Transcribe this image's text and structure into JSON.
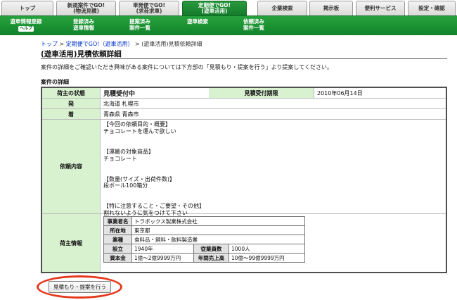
{
  "nav": {
    "tabs": [
      {
        "line1": "トップ",
        "line2": ""
      },
      {
        "line1": "新規案件でGO!",
        "line2": "(物流見積)"
      },
      {
        "line1": "単発便でGO!",
        "line2": "(求荷求車)"
      },
      {
        "line1": "定期便でGO!",
        "line2": "(遊車活用)"
      },
      {
        "line1": "企業検索",
        "line2": ""
      },
      {
        "line1": "掲示板",
        "line2": ""
      },
      {
        "line1": "便利サービス",
        "line2": ""
      },
      {
        "line1": "設定・確認",
        "line2": ""
      }
    ],
    "sub": [
      {
        "line1": "遊車情報登録",
        "line2": "",
        "badge": "ヘルプ"
      },
      {
        "line1": "登録済み",
        "line2": "遊車情報"
      },
      {
        "line1": "提案済み",
        "line2": "案件一覧"
      },
      {
        "line1": "遊車検索",
        "line2": ""
      },
      {
        "line1": "依頼済み",
        "line2": "案件一覧"
      }
    ]
  },
  "breadcrumb": {
    "home": "トップ",
    "sep1": " > ",
    "parent": "定期便でGO!（遊車活用）",
    "sep2": " > ",
    "current": "(遊車活用)見積依頼詳細"
  },
  "page": {
    "title": "(遊車活用)見積依頼詳細",
    "intro": "案件の詳細をご確認いただき興味がある案件については下方部の「見積もり・提案を行う」より提案してください。",
    "section_title": "案件の詳細"
  },
  "detail": {
    "status_label": "荷主の状態",
    "status_value": "見積受付中",
    "deadline_label": "見積受付期限",
    "deadline_value": "2010年06月14日",
    "origin_label": "発",
    "origin_value": "北海道 札幌市",
    "dest_label": "着",
    "dest_value": "青森県 青森市",
    "request_label": "依頼内容",
    "request_text": "【今回の依頼目的・概要】\nチョコレートを運んで欲しい\n\n\n【運搬の対象商品】\nチョコレート\n\n\n【数量(サイズ・出荷件数)】\n段ボール100箱分\n\n\n【特に注意すること・ご要望・その他】\n割れないように気をつけて下さい",
    "shipper_label": "荷主情報"
  },
  "shipper": {
    "company_label": "事業者名",
    "company_value": "トラボックス製業株式会社",
    "location_label": "所在地",
    "location_value": "東京都",
    "industry_label": "業種",
    "industry_value": "食料品・飼料・飲料製造業",
    "founded_label": "設立",
    "founded_value": "1940年",
    "employees_label": "従業員数",
    "employees_value": "1000人",
    "capital_label": "資本金",
    "capital_value": "1億～2億9999万円",
    "sales_label": "年間売上高",
    "sales_value": "10億～99億9999万円"
  },
  "actions": {
    "quote_label": "見積もり・提案を行う"
  },
  "colors": {
    "accent_green": "#12832b",
    "header_cell": "#d8f1cf",
    "highlight_circle": "#e5391e"
  }
}
